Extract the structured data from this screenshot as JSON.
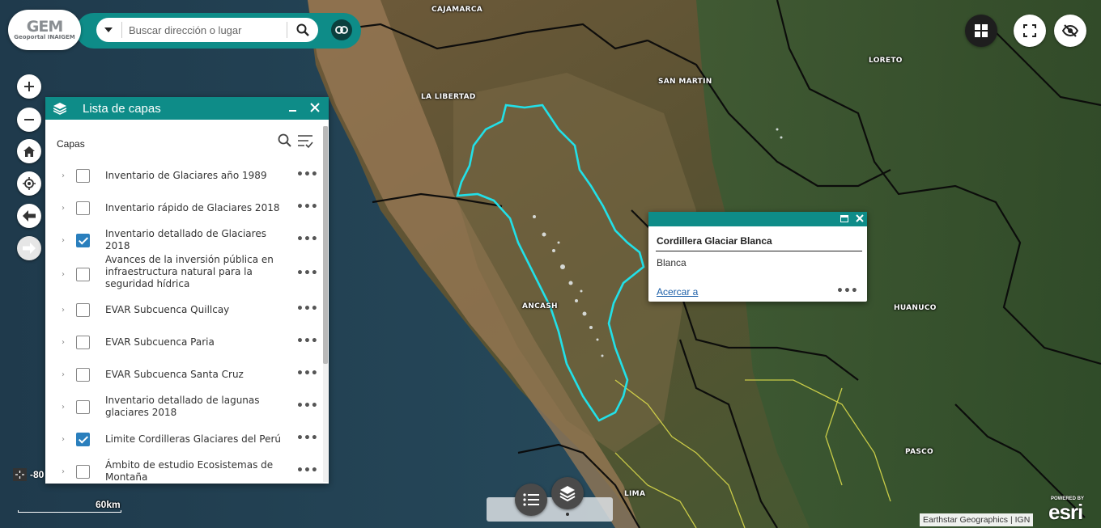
{
  "logo": {
    "main": "GEM",
    "sub": "Geoportal INAIGEM"
  },
  "search": {
    "placeholder": "Buscar dirección o lugar"
  },
  "map": {
    "region_labels": [
      {
        "id": "cajamarca",
        "text": "CAJAMARCA"
      },
      {
        "id": "la-libertad",
        "text": "LA LIBERTAD"
      },
      {
        "id": "san-martin",
        "text": "SAN MARTIN"
      },
      {
        "id": "loreto",
        "text": "LORETO"
      },
      {
        "id": "ancash",
        "text": "ANCASH"
      },
      {
        "id": "huanuco",
        "text": "HUANUCO"
      },
      {
        "id": "pasco",
        "text": "PASCO"
      },
      {
        "id": "lima",
        "text": "LIMA"
      }
    ],
    "glacier_outline_color": "#22e0e8",
    "boundary_color": "#0a0a0a",
    "sub_boundary_color": "#d8d84a"
  },
  "layer_panel": {
    "title": "Lista de capas",
    "toolbar_label": "Capas",
    "layers": [
      {
        "name": "Inventario de Glaciares año 1989",
        "checked": false
      },
      {
        "name": "Inventario rápido de Glaciares 2018",
        "checked": false
      },
      {
        "name": "Inventario detallado de Glaciares 2018",
        "checked": true
      },
      {
        "name": "Avances de la inversión pública en infraestructura natural para la seguridad hídrica",
        "checked": false
      },
      {
        "name": "EVAR Subcuenca Quillcay",
        "checked": false
      },
      {
        "name": "EVAR Subcuenca Paria",
        "checked": false
      },
      {
        "name": "EVAR Subcuenca Santa Cruz",
        "checked": false
      },
      {
        "name": "Inventario detallado de lagunas glaciares 2018",
        "checked": false
      },
      {
        "name": "Limite Cordilleras Glaciares del Perú",
        "checked": true
      },
      {
        "name": "Ámbito de estudio Ecosistemas de Montaña",
        "checked": false
      }
    ],
    "more_label": "•••",
    "expand_label": "›"
  },
  "popup": {
    "title": "Cordillera Glaciar Blanca",
    "value": "Blanca",
    "zoom_link": "Acercar a",
    "more_label": "•••",
    "close_label": "✕"
  },
  "coordinates": {
    "text": "-80"
  },
  "scalebar": {
    "label": "60km"
  },
  "attribution": {
    "text": "Earthstar Geographics | IGN"
  },
  "esri": {
    "powered_by": "POWERED BY",
    "brand": "esri"
  },
  "colors": {
    "accent": "#0e8c88",
    "checkbox": "#2a7fbd",
    "link": "#1c5fa8"
  }
}
